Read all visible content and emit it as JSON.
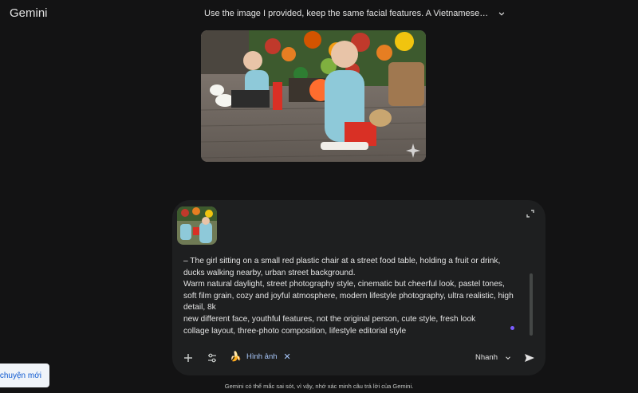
{
  "app": {
    "name": "Gemini"
  },
  "header": {
    "conversation_title": "Use the image I provided, keep the same facial features. A Vietnamese youn..."
  },
  "composer": {
    "prompt_text": "– The girl sitting on a small red plastic chair at a street food table, holding a fruit or drink, ducks walking nearby, urban street background.\nWarm natural daylight, street photography style, cinematic but cheerful look, pastel tones, soft film grain, cozy and joyful atmosphere, modern lifestyle photography, ultra realistic, high detail, 8k\nnew different face, youthful features, not the original person, cute style, fresh look\ncollage layout, three-photo composition, lifestyle editorial style",
    "tool_chip_label": "Hình ảnh",
    "mode_label": "Nhanh"
  },
  "sidebar": {
    "new_chat_label": "ò chuyện mới"
  },
  "footer": {
    "disclaimer": "Gemini có thể mắc sai sót, vì vậy, nhớ xác minh câu trả lời của Gemini."
  },
  "colors": {
    "background": "#131314",
    "composer": "#1e1f20",
    "accent": "#a8c7fa",
    "link": "#0b57d0"
  },
  "icons": [
    "chevron-down-icon",
    "sparkle-icon",
    "collapse-icon",
    "plus-icon",
    "tune-icon",
    "banana-icon",
    "close-icon",
    "send-icon"
  ]
}
